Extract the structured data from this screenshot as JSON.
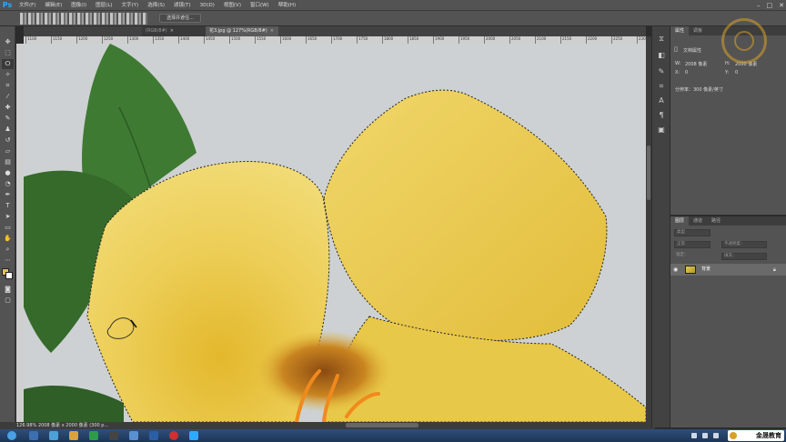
{
  "app": {
    "logo": "Ps"
  },
  "menu": [
    "文件(F)",
    "编辑(E)",
    "图像(I)",
    "图层(L)",
    "文字(Y)",
    "选择(S)",
    "滤镜(T)",
    "3D(D)",
    "视图(V)",
    "窗口(W)",
    "帮助(H)"
  ],
  "window_controls": {
    "minimize": "–",
    "maximize": "□",
    "close": "✕"
  },
  "options_bar": {
    "select_mask_label": "选择并遮住..."
  },
  "tabs": [
    {
      "label": "(RGB/8#)",
      "close": "×"
    },
    {
      "label": "花3.jpg @ 127%(RGB/8#)",
      "close": "×"
    }
  ],
  "ruler_ticks": [
    "1100",
    "1150",
    "1200",
    "1250",
    "1300",
    "1350",
    "1400",
    "1450",
    "1500",
    "1550",
    "1600",
    "1650",
    "1700",
    "1750",
    "1800",
    "1850",
    "1900",
    "1950",
    "2000",
    "2050",
    "2100",
    "2150",
    "2200",
    "2250",
    "2300"
  ],
  "status_bar": {
    "text": "126.98%   2008 像素 x 2000 像素 (300 p..."
  },
  "properties_panel": {
    "tabs": [
      "属性",
      "调板"
    ],
    "section_title": "文档属性",
    "w_label": "W:",
    "w_value": "2008 像素",
    "h_label": "H:",
    "h_value": "2000 像素",
    "x_label": "X:",
    "x_value": "0",
    "y_label": "Y:",
    "y_value": "0",
    "resolution": "分辨率：300 像素/英寸"
  },
  "layers_panel": {
    "tabs": [
      "图层",
      "通道",
      "路径"
    ],
    "kind_label": "类型",
    "mode_label": "正常",
    "opacity_label": "不透明度：",
    "lock_label": "锁定：",
    "fill_label": "填充：",
    "layer_name": "背景"
  },
  "watermark": {
    "text": "金晟教育"
  },
  "colors": {
    "ps_blue": "#31a8ff",
    "watermark_gold": "#d8a028",
    "petal_yellow": "#e9cf52",
    "leaf_green": "#3f7a32",
    "stamen_orange": "#f08a1c"
  }
}
